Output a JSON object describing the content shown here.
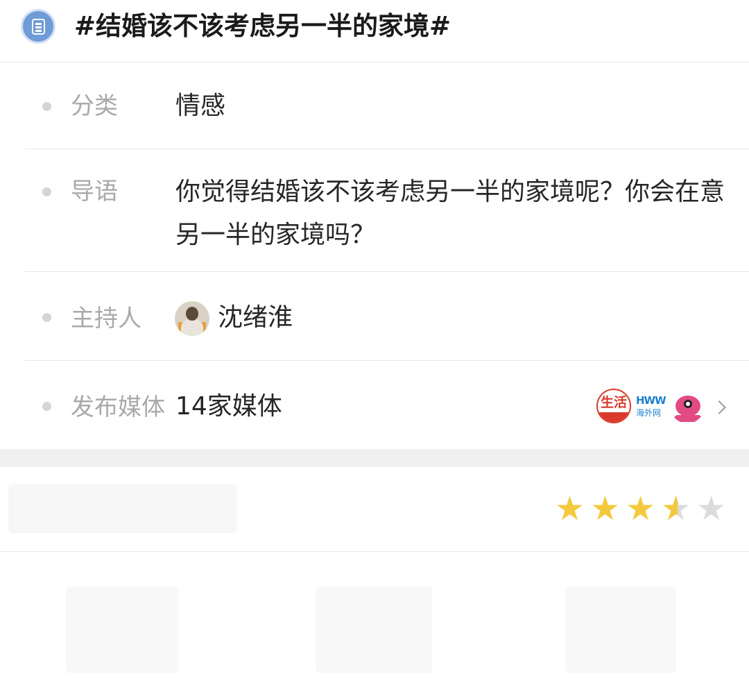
{
  "topic": {
    "title": "#结婚该不该考虑另一半的家境#",
    "icon": "topic-doc-icon"
  },
  "rows": {
    "category": {
      "label": "分类",
      "value": "情感"
    },
    "intro": {
      "label": "导语",
      "value": "你觉得结婚该不该考虑另一半的家境呢？你会在意另一半的家境吗？"
    },
    "host": {
      "label": "主持人",
      "name": "沈绪淮",
      "avatar": "host-avatar"
    },
    "media": {
      "label": "发布媒体",
      "value": "14家媒体",
      "logos": [
        {
          "name": "shenghuo-logo",
          "text": "生活"
        },
        {
          "name": "hww-logo",
          "text": "HWW",
          "sub": "海外网"
        },
        {
          "name": "bird-logo"
        }
      ],
      "chevron": "chevron-right-icon"
    }
  },
  "rating": {
    "stars_total": 5,
    "stars_value": 3.5,
    "star_color": "#f4c93d",
    "star_empty_color": "#dcdcdc"
  },
  "colors": {
    "accent": "#6f9bd6",
    "label": "#a9a9a9",
    "text": "#262626",
    "divider": "#e6e6e6"
  }
}
